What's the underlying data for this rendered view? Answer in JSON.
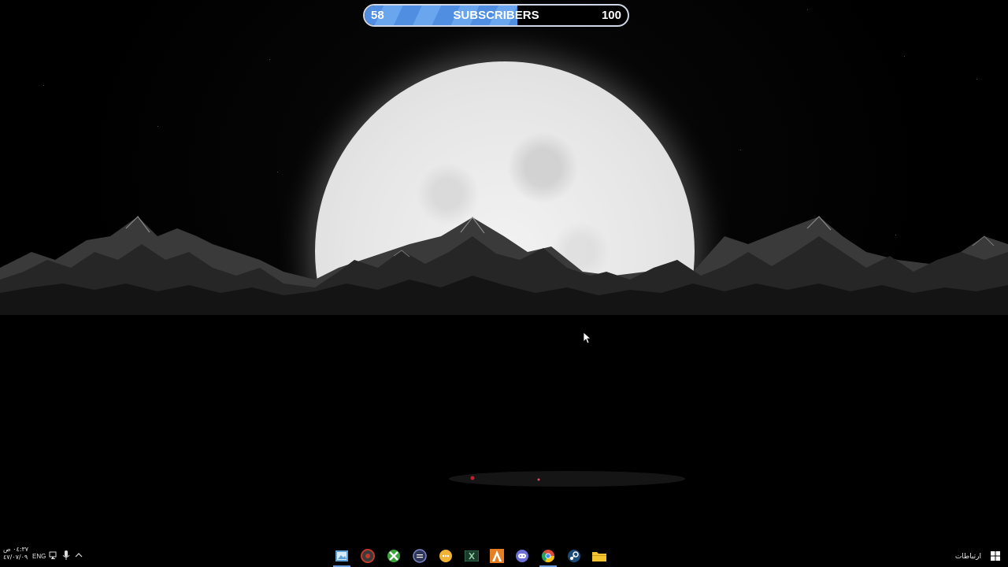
{
  "subscribers_widget": {
    "current": "58",
    "label": "SUBSCRIBERS",
    "goal": "100",
    "progress": 0.58,
    "fill_color": "#4f8ee0"
  },
  "taskbar": {
    "tray": {
      "time": "٠٤:٣٧ ص",
      "date": "٤٧/٠٧/٠٩",
      "language": "ENG",
      "icons": [
        "network-icon",
        "microphone-icon",
        "chevron-up-icon"
      ]
    },
    "notifications_label": "ارتباطات",
    "apps": [
      {
        "name": "photo-viewer",
        "icon": "photo-icon",
        "color": "#5da1d6",
        "active": true
      },
      {
        "name": "camera-app",
        "icon": "camera-icon",
        "color": "#c0392b",
        "active": false
      },
      {
        "name": "xbox-app",
        "icon": "xbox-icon",
        "color": "#3aa63a",
        "active": false
      },
      {
        "name": "game-launcher",
        "icon": "gamepad-icon",
        "color": "#7a86c9",
        "active": false
      },
      {
        "name": "chat-app",
        "icon": "chat-icon",
        "color": "#f2b233",
        "active": false
      },
      {
        "name": "excel-app",
        "icon": "spreadsheet-icon",
        "color": "#1d6f42",
        "active": false
      },
      {
        "name": "arma-app",
        "icon": "arma-icon",
        "color": "#e67e22",
        "active": false
      },
      {
        "name": "discord-app",
        "icon": "discord-icon",
        "color": "#6c6fd8",
        "active": false
      },
      {
        "name": "chrome-app",
        "icon": "chrome-icon",
        "color": "#dd4b39",
        "active": true
      },
      {
        "name": "steam-app",
        "icon": "steam-icon",
        "color": "#1b4a78",
        "active": false
      },
      {
        "name": "file-explorer",
        "icon": "folder-icon",
        "color": "#f4c430",
        "active": false
      }
    ]
  }
}
